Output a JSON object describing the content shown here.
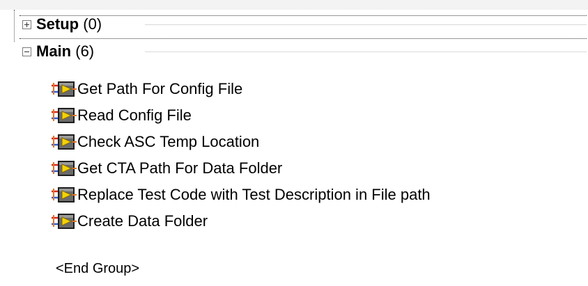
{
  "groups": [
    {
      "name": "Setup",
      "count": "(0)",
      "expanded": false
    },
    {
      "name": "Main",
      "count": "(6)",
      "expanded": true
    }
  ],
  "steps": [
    {
      "label": "Get Path For Config File",
      "icon": "vi-step-icon"
    },
    {
      "label": "Read Config File",
      "icon": "vi-step-icon"
    },
    {
      "label": "Check ASC Temp Location",
      "icon": "vi-step-icon"
    },
    {
      "label": "Get CTA Path For Data Folder",
      "icon": "vi-step-icon"
    },
    {
      "label": "Replace Test Code with Test Description in File path",
      "icon": "vi-step-icon"
    },
    {
      "label": "Create Data Folder",
      "icon": "vi-step-icon"
    }
  ],
  "end_group": "<End Group>",
  "colors": {
    "icon_yellow": "#f2d20a",
    "icon_orange": "#e8711f",
    "icon_red": "#d42a1f",
    "icon_blue": "#2f5fd0",
    "icon_frame": "#1e1e1e",
    "separator": "#d9d9d9"
  }
}
